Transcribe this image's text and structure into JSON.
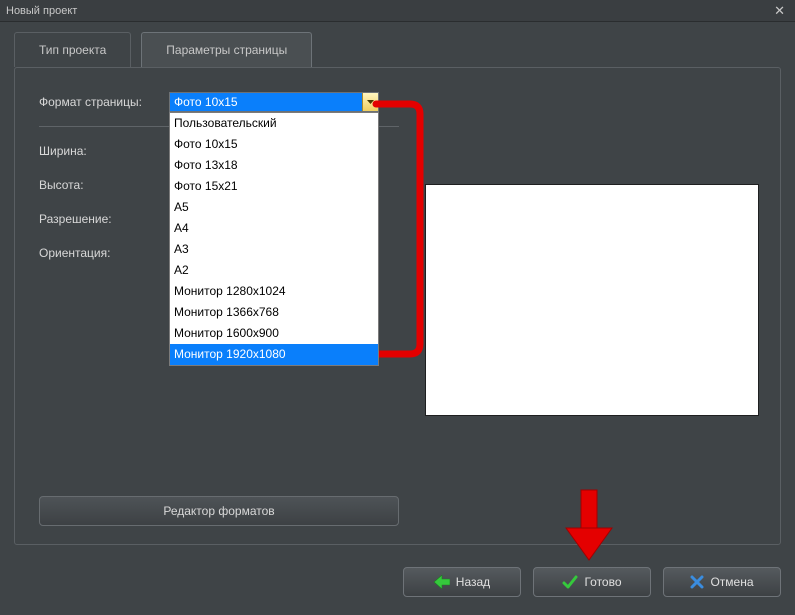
{
  "window": {
    "title": "Новый проект"
  },
  "tabs": {
    "project_type": "Тип проекта",
    "page_params": "Параметры страницы"
  },
  "labels": {
    "page_format": "Формат страницы:",
    "width": "Ширина:",
    "height": "Высота:",
    "resolution": "Разрешение:",
    "orientation": "Ориентация:"
  },
  "combo": {
    "selected": "Фото 10x15",
    "options": [
      "Пользовательский",
      "Фото 10x15",
      "Фото 13x18",
      "Фото 15x21",
      "A5",
      "A4",
      "A3",
      "A2",
      "Монитор 1280x1024",
      "Монитор 1366x768",
      "Монитор 1600x900",
      "Монитор 1920x1080"
    ],
    "highlighted_index": 11
  },
  "buttons": {
    "format_editor": "Редактор форматов",
    "back": "Назад",
    "done": "Готово",
    "cancel": "Отмена"
  },
  "colors": {
    "accent_red": "#e40000",
    "selection_blue": "#0a7ffb"
  }
}
